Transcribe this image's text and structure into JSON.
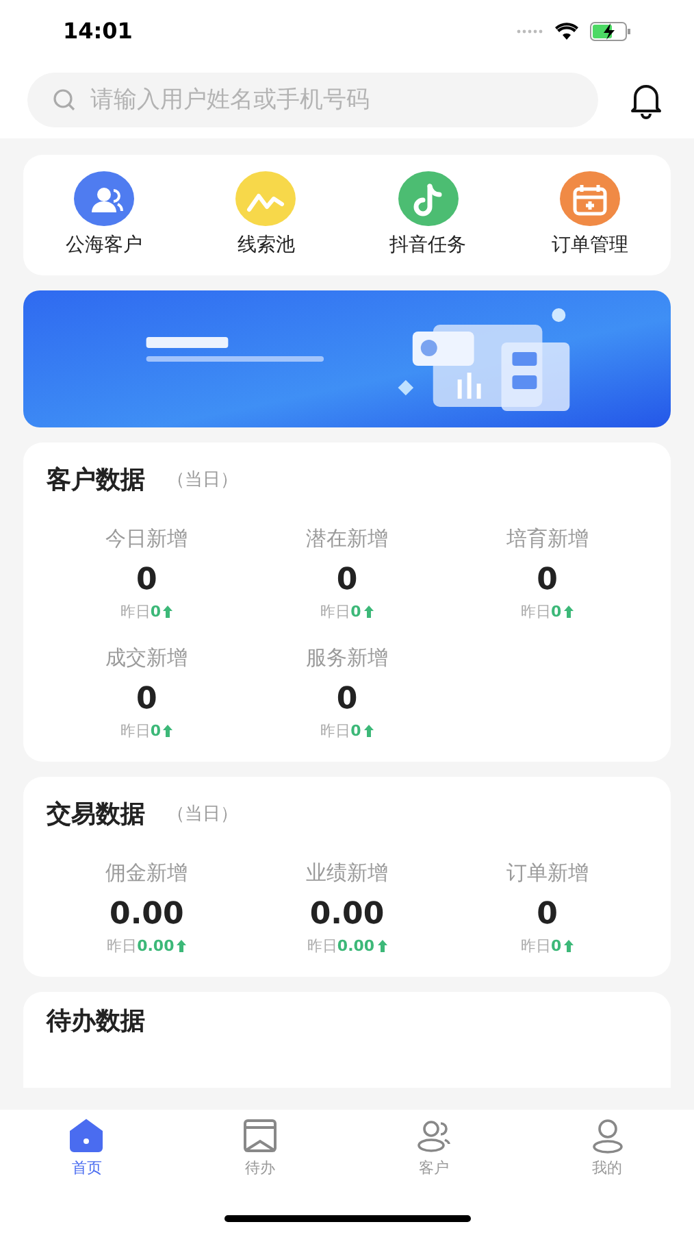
{
  "status_bar": {
    "time": "14:01"
  },
  "search": {
    "placeholder": "请输入用户姓名或手机号码"
  },
  "shortcuts": [
    {
      "label": "公海客户",
      "kind": "customers",
      "color": "#4f7cf0"
    },
    {
      "label": "线索池",
      "kind": "leads",
      "color": "#f7d84a"
    },
    {
      "label": "抖音任务",
      "kind": "music",
      "color": "#4cbd72"
    },
    {
      "label": "订单管理",
      "kind": "orders",
      "color": "#f08a45"
    }
  ],
  "sections": [
    {
      "title": "客户数据",
      "period": "（当日）",
      "stats": [
        {
          "label": "今日新增",
          "value": "0",
          "yesterday_label": "昨日",
          "yesterday_value": "0"
        },
        {
          "label": "潜在新增",
          "value": "0",
          "yesterday_label": "昨日",
          "yesterday_value": "0"
        },
        {
          "label": "培育新增",
          "value": "0",
          "yesterday_label": "昨日",
          "yesterday_value": "0"
        },
        {
          "label": "成交新增",
          "value": "0",
          "yesterday_label": "昨日",
          "yesterday_value": "0"
        },
        {
          "label": "服务新增",
          "value": "0",
          "yesterday_label": "昨日",
          "yesterday_value": "0"
        }
      ]
    },
    {
      "title": "交易数据",
      "period": "（当日）",
      "stats": [
        {
          "label": "佣金新增",
          "value": "0.00",
          "yesterday_label": "昨日",
          "yesterday_value": "0.00"
        },
        {
          "label": "业绩新增",
          "value": "0.00",
          "yesterday_label": "昨日",
          "yesterday_value": "0.00"
        },
        {
          "label": "订单新增",
          "value": "0",
          "yesterday_label": "昨日",
          "yesterday_value": "0"
        }
      ]
    }
  ],
  "todo": {
    "title": "待办数据"
  },
  "tabs": [
    {
      "label": "首页",
      "kind": "home",
      "selected": true
    },
    {
      "label": "待办",
      "kind": "todo",
      "selected": false
    },
    {
      "label": "客户",
      "kind": "customers",
      "selected": false
    },
    {
      "label": "我的",
      "kind": "me",
      "selected": false
    }
  ]
}
